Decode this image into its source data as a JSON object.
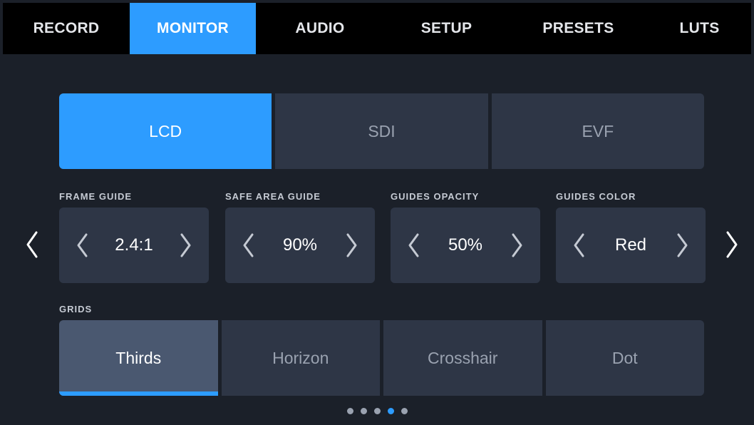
{
  "tabs": [
    {
      "label": "RECORD",
      "active": false
    },
    {
      "label": "MONITOR",
      "active": true
    },
    {
      "label": "AUDIO",
      "active": false
    },
    {
      "label": "SETUP",
      "active": false
    },
    {
      "label": "PRESETS",
      "active": false
    },
    {
      "label": "LUTS",
      "active": false
    }
  ],
  "outputs": [
    {
      "label": "LCD",
      "active": true
    },
    {
      "label": "SDI",
      "active": false
    },
    {
      "label": "EVF",
      "active": false
    }
  ],
  "settings": {
    "frame_guide": {
      "label": "FRAME GUIDE",
      "value": "2.4:1"
    },
    "safe_area_guide": {
      "label": "SAFE AREA GUIDE",
      "value": "90%"
    },
    "guides_opacity": {
      "label": "GUIDES OPACITY",
      "value": "50%"
    },
    "guides_color": {
      "label": "GUIDES COLOR",
      "value": "Red"
    }
  },
  "grids": {
    "label": "GRIDS",
    "options": [
      {
        "label": "Thirds",
        "active": true
      },
      {
        "label": "Horizon",
        "active": false
      },
      {
        "label": "Crosshair",
        "active": false
      },
      {
        "label": "Dot",
        "active": false
      }
    ]
  },
  "pagination": {
    "count": 5,
    "current": 4
  },
  "colors": {
    "accent": "#2d9cff",
    "background": "#1b2029",
    "panel": "#2e3646",
    "tabbar": "#000000"
  },
  "icons": {
    "prev": "chevron-left-icon",
    "next": "chevron-right-icon"
  }
}
